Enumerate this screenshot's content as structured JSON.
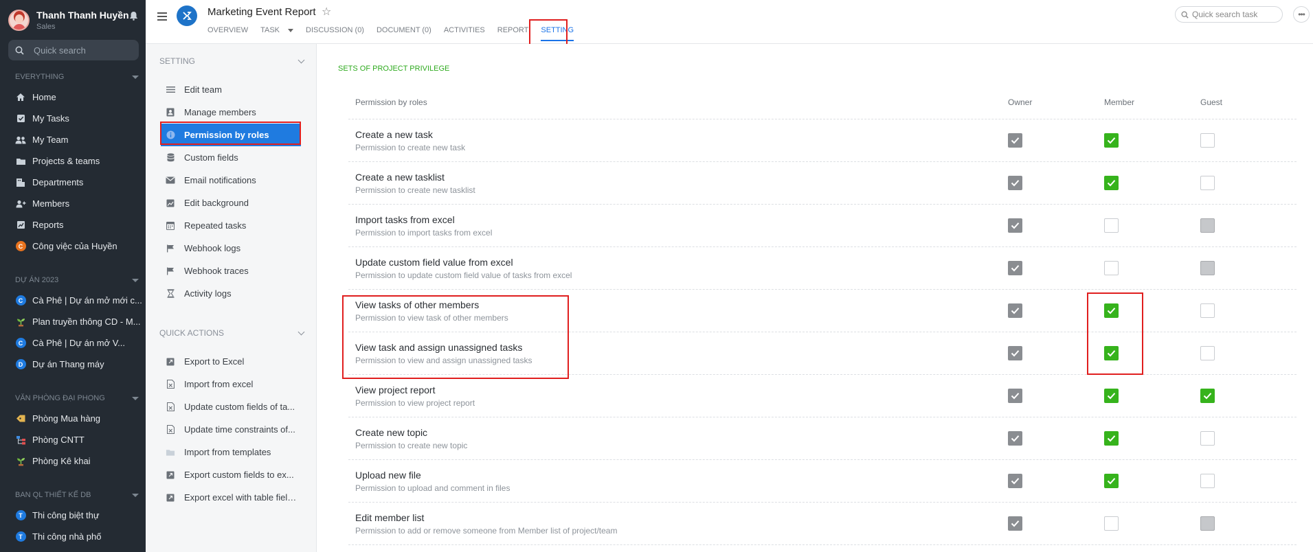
{
  "profile": {
    "name": "Thanh Thanh Huyền",
    "role": "Sales"
  },
  "sidebar": {
    "search_placeholder": "Quick search",
    "sections": [
      {
        "title": "EVERYTHING",
        "items": [
          {
            "label": "Home",
            "icon": "home-icon"
          },
          {
            "label": "My Tasks",
            "icon": "checkbox-icon"
          },
          {
            "label": "My Team",
            "icon": "team-icon"
          },
          {
            "label": "Projects & teams",
            "icon": "folder-icon"
          },
          {
            "label": "Departments",
            "icon": "department-icon"
          },
          {
            "label": "Members",
            "icon": "members-icon"
          },
          {
            "label": "Reports",
            "icon": "chart-icon"
          },
          {
            "label": "Công việc của Huyền",
            "icon": "letter-c",
            "letter": "C",
            "color": "#e8731e"
          }
        ]
      },
      {
        "title": "DỰ ÁN 2023",
        "items": [
          {
            "label": "Cà Phê | Dự án mở mới c...",
            "letter": "C",
            "color": "#1f7be0"
          },
          {
            "label": "Plan truyền thông CD - M...",
            "icon": "plant-icon"
          },
          {
            "label": "Cà Phê | Dự án mở V...",
            "letter": "C",
            "color": "#1f7be0"
          },
          {
            "label": "Dự án Thang máy",
            "letter": "D",
            "color": "#1f7be0"
          }
        ]
      },
      {
        "title": "VĂN PHÒNG ĐẠI PHONG",
        "items": [
          {
            "label": "Phòng Mua hàng",
            "icon": "tag-icon"
          },
          {
            "label": "Phòng CNTT",
            "icon": "org-icon"
          },
          {
            "label": "Phòng Kê khai",
            "icon": "plant-icon"
          }
        ]
      },
      {
        "title": "BAN QL THIẾT KẾ DB",
        "items": [
          {
            "label": "Thi công biệt thự",
            "letter": "T",
            "color": "#1f7be0"
          },
          {
            "label": "Thi công nhà phố",
            "letter": "T",
            "color": "#1f7be0"
          }
        ]
      }
    ]
  },
  "header": {
    "title": "Marketing Event Report",
    "logo_letter": "X",
    "tabs": [
      "OVERVIEW",
      "TASK",
      "DISCUSSION (0)",
      "DOCUMENT (0)",
      "ACTIVITIES",
      "REPORT",
      "SETTING"
    ],
    "active_tab": "SETTING",
    "search_placeholder": "Quick search task"
  },
  "setting_menu": {
    "setting_title": "SETTING",
    "setting_items": [
      {
        "label": "Edit team",
        "icon": "list-icon"
      },
      {
        "label": "Manage members",
        "icon": "user-box-icon"
      },
      {
        "label": "Permission by roles",
        "icon": "info-icon",
        "active": true
      },
      {
        "label": "Custom fields",
        "icon": "database-icon"
      },
      {
        "label": "Email notifications",
        "icon": "mail-icon"
      },
      {
        "label": "Edit background",
        "icon": "image-icon"
      },
      {
        "label": "Repeated tasks",
        "icon": "calendar-icon"
      },
      {
        "label": "Webhook logs",
        "icon": "flag-icon"
      },
      {
        "label": "Webhook traces",
        "icon": "flag-icon"
      },
      {
        "label": "Activity logs",
        "icon": "hourglass-icon"
      }
    ],
    "quick_title": "QUICK ACTIONS",
    "quick_items": [
      {
        "label": "Export to Excel",
        "icon": "export-icon"
      },
      {
        "label": "Import from excel",
        "icon": "excel-icon"
      },
      {
        "label": "Update custom fields of ta...",
        "icon": "excel-icon"
      },
      {
        "label": "Update time constraints of...",
        "icon": "excel-icon"
      },
      {
        "label": "Import from templates",
        "icon": "folder-icon"
      },
      {
        "label": "Export custom fields to ex...",
        "icon": "export-icon"
      },
      {
        "label": "Export excel with table fields",
        "icon": "export-icon"
      }
    ]
  },
  "permissions": {
    "section_title": "SETS OF PROJECT PRIVILEGE",
    "headers": {
      "name": "Permission by roles",
      "owner": "Owner",
      "member": "Member",
      "guest": "Guest"
    },
    "rows": [
      {
        "title": "Create a new task",
        "desc": "Permission to create new task",
        "owner": "locked",
        "member": "on",
        "guest": "off"
      },
      {
        "title": "Create a new tasklist",
        "desc": "Permission to create new tasklist",
        "owner": "locked",
        "member": "on",
        "guest": "off"
      },
      {
        "title": "Import tasks from excel",
        "desc": "Permission to import tasks from excel",
        "owner": "locked",
        "member": "off",
        "guest": "disabled"
      },
      {
        "title": "Update custom field value from excel",
        "desc": "Permission to update custom field value of tasks from excel",
        "owner": "locked",
        "member": "off",
        "guest": "disabled"
      },
      {
        "title": "View tasks of other members",
        "desc": "Permission to view task of other members",
        "owner": "locked",
        "member": "on",
        "guest": "off"
      },
      {
        "title": "View task and assign unassigned tasks",
        "desc": "Permission to view and assign unassigned tasks",
        "owner": "locked",
        "member": "on",
        "guest": "off"
      },
      {
        "title": "View project report",
        "desc": "Permission to view project report",
        "owner": "locked",
        "member": "on",
        "guest": "on"
      },
      {
        "title": "Create new topic",
        "desc": "Permission to create new topic",
        "owner": "locked",
        "member": "on",
        "guest": "off"
      },
      {
        "title": "Upload new file",
        "desc": "Permission to upload and comment in files",
        "owner": "locked",
        "member": "on",
        "guest": "off"
      },
      {
        "title": "Edit member list",
        "desc": "Permission to add or remove someone from Member list of project/team",
        "owner": "locked",
        "member": "off",
        "guest": "disabled"
      }
    ]
  }
}
